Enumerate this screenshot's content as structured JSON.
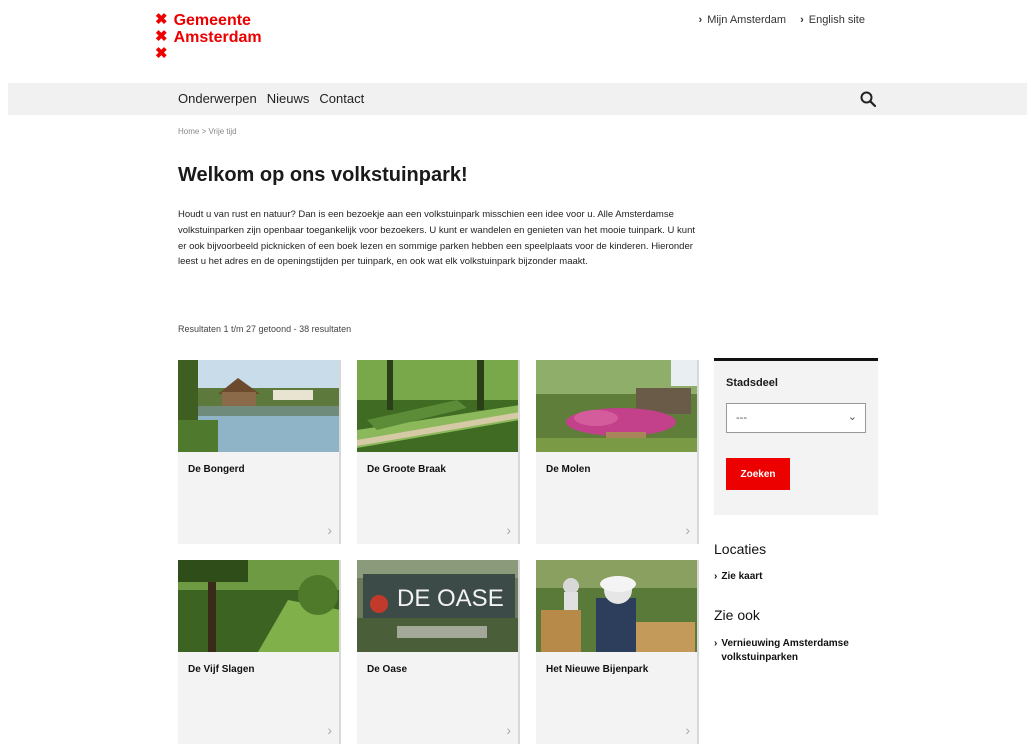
{
  "header": {
    "logo_line1": "Gemeente",
    "logo_line2": "Amsterdam",
    "top_links": [
      "Mijn Amsterdam",
      "English site"
    ]
  },
  "nav": {
    "items": [
      "Onderwerpen",
      "Nieuws",
      "Contact"
    ]
  },
  "breadcrumb": "Home > Vrije tijd",
  "main": {
    "title": "Welkom op ons volkstuinpark!",
    "intro": "Houdt u van rust en natuur? Dan is een bezoekje aan een volkstuinpark misschien een idee voor u. Alle Amsterdamse volkstuinparken zijn openbaar toegankelijk voor bezoekers. U kunt er wandelen en genieten van het mooie tuinpark. U kunt er ook bijvoorbeeld picknicken of een boek lezen en sommige parken hebben een speelplaats voor de kinderen. Hieronder leest u het adres en de openingstijden per tuinpark, en ook wat elk volkstuinpark bijzonder maakt.",
    "results": "Resultaten 1 t/m 27 getoond - 38 resultaten"
  },
  "cards": [
    {
      "title": "De Bongerd"
    },
    {
      "title": "De Groote Braak"
    },
    {
      "title": "De Molen"
    },
    {
      "title": "De Vijf Slagen"
    },
    {
      "title": "De Oase"
    },
    {
      "title": "Het Nieuwe Bijenpark"
    }
  ],
  "oase_sign": "DE OASE",
  "sidebar": {
    "filter_label": "Stadsdeel",
    "select_value": "---",
    "search_button": "Zoeken",
    "locations_heading": "Locaties",
    "map_link": "Zie kaart",
    "see_also_heading": "Zie ook",
    "see_also_link": "Vernieuwing Amsterdamse volkstuinparken"
  },
  "colors": {
    "brand_red": "#ec0000",
    "nav_bg": "#f1f1f1",
    "card_bg": "#f3f3f3"
  },
  "icons": {
    "logo": "x-crosses",
    "search": "magnifier-icon",
    "chevron": "chevron-right-icon"
  }
}
